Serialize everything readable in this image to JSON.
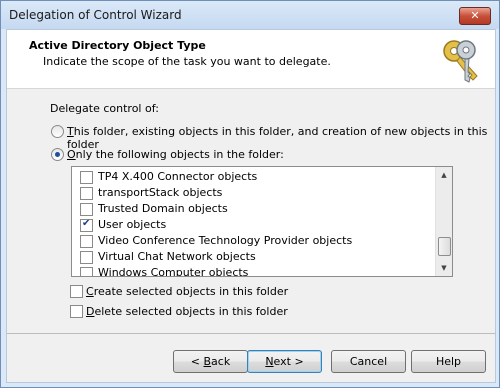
{
  "window": {
    "title": "Delegation of Control Wizard",
    "close_glyph": "✕"
  },
  "header": {
    "title": "Active Directory Object Type",
    "subtitle": "Indicate the scope of the task you want to delegate.",
    "icon": "keys-icon"
  },
  "body": {
    "delegate_label": "Delegate control of:",
    "radio_this_folder": {
      "prefix": "",
      "underline": "T",
      "rest": "his folder, existing objects in this folder, and creation of new objects in this folder",
      "checked": false
    },
    "radio_only_following": {
      "prefix": "",
      "underline": "O",
      "rest": "nly the following objects in the folder:",
      "checked": true
    }
  },
  "object_list": {
    "items": [
      {
        "label": "TP4 X.400 Connector objects",
        "checked": false
      },
      {
        "label": "transportStack objects",
        "checked": false
      },
      {
        "label": "Trusted Domain objects",
        "checked": false
      },
      {
        "label": "User objects",
        "checked": true
      },
      {
        "label": "Video Conference Technology Provider objects",
        "checked": false
      },
      {
        "label": "Virtual Chat Network objects",
        "checked": false
      },
      {
        "label": "Windows Computer objects",
        "checked": false
      }
    ],
    "scroll_up_glyph": "▲",
    "scroll_down_glyph": "▼"
  },
  "options": {
    "create": {
      "underline": "C",
      "rest": "reate selected objects in this folder",
      "checked": false
    },
    "delete": {
      "underline": "D",
      "rest": "elete selected objects in this folder",
      "checked": false
    }
  },
  "buttons": {
    "back": {
      "prefix": "< ",
      "underline": "B",
      "rest": "ack"
    },
    "next": {
      "prefix": "",
      "underline": "N",
      "rest": "ext >"
    },
    "cancel": "Cancel",
    "help": "Help"
  }
}
